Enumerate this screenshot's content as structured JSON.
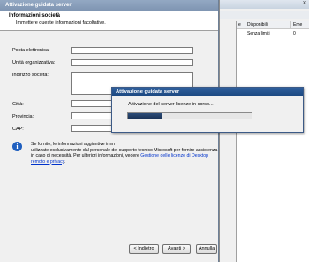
{
  "background_window": {
    "close_glyph": "✕",
    "columns": [
      "e",
      "Disponibili",
      "Eme"
    ],
    "row": [
      "",
      "Senza limiti",
      "0"
    ]
  },
  "wizard": {
    "title": "Attivazione guidata server",
    "header": {
      "title": "Informazioni società",
      "subtitle": "Immettere queste informazioni facoltative."
    },
    "fields": [
      {
        "label": "Posta elettronica:",
        "value": ""
      },
      {
        "label": "Unità organizzativa:",
        "value": ""
      },
      {
        "label": "Indirizzo società:",
        "value": ""
      },
      {
        "label": "Città:",
        "value": ""
      },
      {
        "label": "Provincia:",
        "value": ""
      },
      {
        "label": "CAP:",
        "value": ""
      }
    ],
    "info_text_1": "Se fornite, le informazioni aggiuntive imm",
    "info_text_2": "utilizzate esclusivamente dal personale del supporto tecnico Microsoft per fornire assistenza in caso di necessità. Per ulteriori informazioni, vedere",
    "info_link": "Gestione delle licenze di Desktop remoto e privacy",
    "buttons": {
      "back": "< Indietro",
      "next": "Avanti >",
      "cancel": "Annulla"
    }
  },
  "progress_dialog": {
    "title": "Attivazione guidata server",
    "message": "Attivazione del server licenze in corso...",
    "progress": 0.28
  },
  "colors": {
    "desktop": "#7a96b4",
    "progress_fill": "#1a3357",
    "link": "#0033cc"
  }
}
